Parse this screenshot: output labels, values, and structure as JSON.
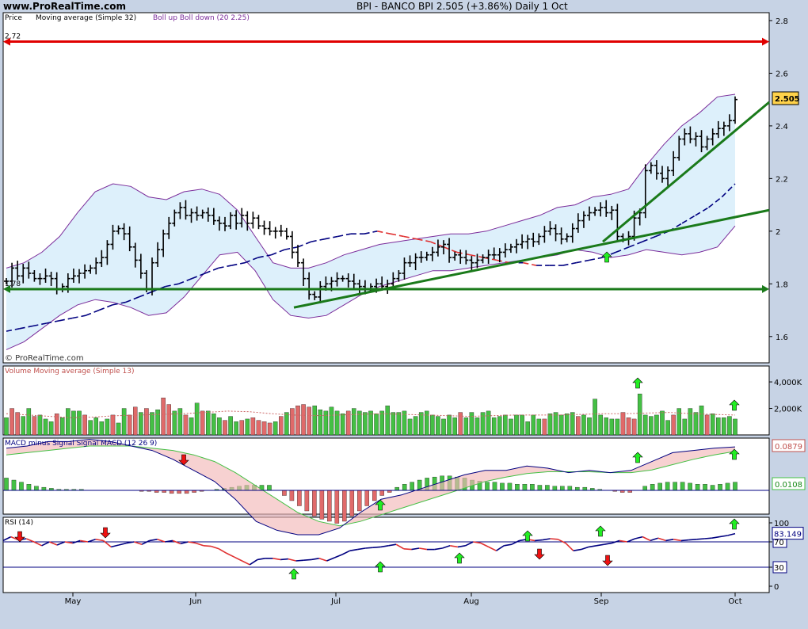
{
  "header": {
    "site": "www.ProRealTime.com",
    "title": "BPI - BANCO BPI    2.505 (+3.86%)    Daily  1 Oct"
  },
  "colors": {
    "price_bar": "#000000",
    "moving_average_up": "#000080",
    "moving_average_down": "#e03030",
    "bollinger_band": "#7b2c9a",
    "bollinger_fill": "#ddf0fb",
    "resistance_line": "#e00000",
    "support_line": "#1a7a1a",
    "volume_up": "#44c044",
    "volume_down": "#e06a6a",
    "macd_line": "#000080",
    "signal_line": "#44c044",
    "rsi_line": "#000080",
    "arrow_buy": "#22ee22",
    "arrow_sell": "#ee1111"
  },
  "chart_data": [
    {
      "type": "candlestick",
      "name": "price",
      "legend": [
        "Price",
        "Moving average (Simple 32)",
        "Boll up Boll down (20 2.25)"
      ],
      "ylim": [
        1.5,
        2.83
      ],
      "y_ticks": [
        "2.8",
        "2.6",
        "2.4",
        "2.2",
        "2",
        "1.8",
        "1.6"
      ],
      "x_labels": [
        "May",
        "Jun",
        "Jul",
        "Aug",
        "Sep",
        "Oct"
      ],
      "last_value_label": "2.505",
      "horizontal_levels": [
        {
          "label": "2.72",
          "value": 2.72,
          "style": "resistance"
        },
        {
          "label": "1.78",
          "value": 1.78,
          "style": "support"
        }
      ],
      "trendlines": [
        {
          "from": [
            "Jun 25",
            1.71
          ],
          "to": [
            "Oct 14",
            2.08
          ]
        },
        {
          "from": [
            "Sep 1",
            1.96
          ],
          "to": [
            "Oct 14",
            2.49
          ]
        }
      ],
      "close": [
        1.81,
        1.86,
        1.83,
        1.86,
        1.84,
        1.82,
        1.82,
        1.83,
        1.82,
        1.78,
        1.79,
        1.82,
        1.83,
        1.84,
        1.85,
        1.86,
        1.88,
        1.9,
        1.95,
        2.0,
        2.01,
        1.99,
        1.94,
        1.89,
        1.84,
        1.78,
        1.88,
        1.93,
        1.99,
        2.03,
        2.07,
        2.09,
        2.06,
        2.07,
        2.06,
        2.07,
        2.06,
        2.04,
        2.03,
        2.02,
        2.06,
        2.03,
        2.06,
        2.03,
        2.05,
        2.02,
        2.01,
        2.0,
        2.0,
        2.0,
        1.98,
        1.92,
        1.88,
        1.82,
        1.76,
        1.75,
        1.79,
        1.8,
        1.81,
        1.82,
        1.82,
        1.81,
        1.8,
        1.79,
        1.78,
        1.79,
        1.8,
        1.79,
        1.8,
        1.82,
        1.84,
        1.88,
        1.88,
        1.9,
        1.9,
        1.91,
        1.92,
        1.94,
        1.95,
        1.9,
        1.91,
        1.9,
        1.89,
        1.88,
        1.89,
        1.9,
        1.91,
        1.91,
        1.92,
        1.93,
        1.94,
        1.95,
        1.96,
        1.97,
        1.96,
        1.98,
        2.0,
        2.01,
        1.99,
        1.97,
        1.98,
        2.01,
        2.04,
        2.06,
        2.07,
        2.08,
        2.09,
        2.07,
        2.08,
        1.98,
        1.97,
        1.98,
        2.05,
        2.07,
        2.23,
        2.25,
        2.22,
        2.2,
        2.23,
        2.28,
        2.35,
        2.37,
        2.35,
        2.36,
        2.32,
        2.35,
        2.37,
        2.39,
        2.4,
        2.42,
        2.5
      ],
      "moving_average": [
        1.62,
        1.63,
        1.64,
        1.65,
        1.66,
        1.67,
        1.68,
        1.7,
        1.72,
        1.73,
        1.75,
        1.77,
        1.79,
        1.8,
        1.82,
        1.84,
        1.86,
        1.87,
        1.88,
        1.9,
        1.91,
        1.93,
        1.94,
        1.96,
        1.97,
        1.98,
        1.99,
        1.99,
        2.0,
        1.99,
        1.98,
        1.97,
        1.96,
        1.94,
        1.92,
        1.91,
        1.9,
        1.89,
        1.88,
        1.88,
        1.87,
        1.87,
        1.87,
        1.88,
        1.89,
        1.9,
        1.92,
        1.94,
        1.96,
        1.98,
        2.0,
        2.03,
        2.06,
        2.09,
        2.13,
        2.18
      ],
      "bollinger_upper": [
        1.86,
        1.88,
        1.92,
        1.98,
        2.07,
        2.15,
        2.18,
        2.17,
        2.13,
        2.12,
        2.15,
        2.16,
        2.14,
        2.08,
        1.98,
        1.88,
        1.86,
        1.86,
        1.88,
        1.91,
        1.93,
        1.95,
        1.96,
        1.97,
        1.98,
        1.99,
        1.99,
        2.0,
        2.02,
        2.04,
        2.06,
        2.09,
        2.1,
        2.13,
        2.14,
        2.16,
        2.25,
        2.33,
        2.4,
        2.45,
        2.51,
        2.52
      ],
      "bollinger_lower": [
        1.55,
        1.58,
        1.63,
        1.68,
        1.72,
        1.74,
        1.73,
        1.71,
        1.68,
        1.69,
        1.75,
        1.83,
        1.91,
        1.92,
        1.85,
        1.74,
        1.68,
        1.67,
        1.68,
        1.72,
        1.76,
        1.79,
        1.81,
        1.83,
        1.85,
        1.85,
        1.86,
        1.87,
        1.88,
        1.89,
        1.9,
        1.91,
        1.93,
        1.92,
        1.9,
        1.91,
        1.93,
        1.92,
        1.91,
        1.92,
        1.94,
        2.02
      ]
    },
    {
      "type": "bar",
      "name": "volume",
      "legend": "Volume Moving average (Simple 13)",
      "y_ticks": [
        "4,000K",
        "2,000K"
      ],
      "values": [
        1300,
        2000,
        1700,
        1400,
        2000,
        1400,
        1500,
        1200,
        1000,
        1600,
        1300,
        2000,
        1800,
        1800,
        1500,
        1100,
        1300,
        1000,
        1200,
        1500,
        900,
        2000,
        1500,
        2100,
        1700,
        2000,
        1700,
        1900,
        2800,
        2300,
        1800,
        2000,
        1500,
        1300,
        2400,
        1800,
        1800,
        1600,
        1300,
        1100,
        1400,
        1000,
        1100,
        1200,
        1300,
        1100,
        1000,
        900,
        1000,
        1400,
        1700,
        2000,
        2200,
        2300,
        2100,
        2200,
        1900,
        1800,
        2100,
        1800,
        1600,
        1800,
        2000,
        1800,
        1700,
        1800,
        1600,
        1800,
        2200,
        1700,
        1700,
        1800,
        1200,
        1400,
        1700,
        1800,
        1500,
        1400,
        1200,
        1500,
        1300,
        1700,
        1300,
        1700,
        1300,
        1700,
        1800,
        1300,
        1400,
        1500,
        1200,
        1500,
        1500,
        1000,
        1500,
        1200,
        1200,
        1600,
        1700,
        1500,
        1600,
        1700,
        1400,
        1500,
        1300,
        2700,
        1500,
        1300,
        1200,
        1200,
        1700,
        1300,
        1200,
        3100,
        1500,
        1400,
        1500,
        1800,
        1100,
        1500,
        2000,
        1200,
        2000,
        1700,
        2200,
        1500,
        1600,
        1300,
        1300,
        1400,
        1200
      ],
      "up_days": [
        1,
        0,
        0,
        1,
        1,
        0,
        1,
        1,
        1,
        0,
        1,
        1,
        1,
        1,
        0,
        1,
        1,
        1,
        1,
        0,
        1,
        1,
        0,
        0,
        1,
        0,
        1,
        1,
        0,
        0,
        1,
        1,
        0,
        1,
        1,
        0,
        1,
        1,
        1,
        0,
        1,
        1,
        0,
        1,
        0,
        0,
        0,
        0,
        1,
        0,
        1,
        0,
        0,
        0,
        0,
        1,
        1,
        1,
        1,
        1,
        1,
        0,
        1,
        1,
        1,
        1,
        1,
        1,
        1,
        1,
        1,
        1,
        1,
        1,
        1,
        1,
        1,
        1,
        1,
        1,
        1,
        0,
        1,
        1,
        1,
        1,
        1,
        1,
        1,
        1,
        1,
        1,
        1,
        1,
        1,
        1,
        0,
        1,
        1,
        1,
        1,
        1,
        0,
        1,
        1,
        1,
        1,
        1,
        1,
        1,
        0,
        0,
        0,
        1,
        1,
        1,
        1,
        1,
        1,
        0,
        1,
        1,
        1,
        1,
        1,
        0,
        1,
        1,
        1,
        1,
        1
      ],
      "moving_average": [
        1600,
        1500,
        1400,
        1300,
        1350,
        1450,
        1500,
        1550,
        1600,
        1700,
        1800,
        1750,
        1600,
        1500,
        1450,
        1500,
        1550,
        1600,
        1550,
        1500,
        1450,
        1400,
        1450,
        1500,
        1500,
        1500,
        1550,
        1600,
        1600,
        1650,
        1700,
        1600,
        1550,
        1500
      ]
    },
    {
      "type": "line",
      "name": "macd",
      "legend": "MACD minus Signal Signal MACD (12 26 9)",
      "value_labels": [
        "0.0879",
        "0.0108"
      ],
      "macd": [
        0.095,
        0.1,
        0.11,
        0.11,
        0.115,
        0.11,
        0.1,
        0.09,
        0.07,
        0.045,
        0.02,
        -0.02,
        -0.07,
        -0.09,
        -0.1,
        -0.1,
        -0.085,
        -0.05,
        -0.02,
        -0.01,
        0.005,
        0.02,
        0.035,
        0.045,
        0.045,
        0.055,
        0.05,
        0.04,
        0.045,
        0.04,
        0.045,
        0.065,
        0.085,
        0.09,
        0.095,
        0.098
      ],
      "signal": [
        0.08,
        0.085,
        0.09,
        0.095,
        0.1,
        0.1,
        0.1,
        0.095,
        0.09,
        0.08,
        0.065,
        0.04,
        0.01,
        -0.02,
        -0.05,
        -0.07,
        -0.08,
        -0.07,
        -0.055,
        -0.04,
        -0.025,
        -0.01,
        0.005,
        0.02,
        0.03,
        0.038,
        0.042,
        0.042,
        0.042,
        0.04,
        0.04,
        0.046,
        0.058,
        0.07,
        0.08,
        0.088
      ],
      "histogram": [
        0.012,
        0.01,
        0.008,
        0.006,
        0.004,
        0.003,
        0.002,
        0.001,
        0.001,
        0.001,
        0.001,
        0.0,
        0.0,
        0.0,
        0.0,
        0.0,
        0.0,
        0.0,
        -0.001,
        -0.001,
        -0.002,
        -0.002,
        -0.003,
        -0.003,
        -0.003,
        -0.002,
        -0.001,
        0.0,
        0.001,
        0.002,
        0.003,
        0.004,
        0.005,
        0.005,
        0.005,
        0.005,
        0.0,
        -0.005,
        -0.01,
        -0.015,
        -0.02,
        -0.025,
        -0.028,
        -0.03,
        -0.032,
        -0.03,
        -0.025,
        -0.02,
        -0.015,
        -0.01,
        -0.005,
        -0.002,
        0.003,
        0.006,
        0.008,
        0.01,
        0.012,
        0.013,
        0.014,
        0.014,
        0.013,
        0.012,
        0.01,
        0.009,
        0.008,
        0.008,
        0.007,
        0.007,
        0.006,
        0.006,
        0.006,
        0.005,
        0.005,
        0.004,
        0.004,
        0.004,
        0.003,
        0.003,
        0.002,
        0.001,
        0.0,
        -0.001,
        -0.002,
        -0.002,
        0.0,
        0.004,
        0.006,
        0.007,
        0.008,
        0.008,
        0.008,
        0.007,
        0.006,
        0.006,
        0.005,
        0.006,
        0.007,
        0.008
      ]
    },
    {
      "type": "line",
      "name": "rsi",
      "legend": "RSI (14)",
      "y_ticks": [
        "100",
        "70",
        "30",
        "0"
      ],
      "last_value_label": "83.149",
      "levels": [
        70,
        30
      ],
      "values": [
        72,
        78,
        73,
        75,
        70,
        64,
        70,
        65,
        70,
        68,
        72,
        70,
        74,
        72,
        62,
        65,
        68,
        70,
        66,
        72,
        74,
        70,
        72,
        67,
        70,
        68,
        64,
        63,
        59,
        52,
        46,
        40,
        34,
        42,
        44,
        44,
        42,
        43,
        40,
        41,
        42,
        44,
        40,
        45,
        50,
        56,
        58,
        60,
        61,
        62,
        64,
        66,
        59,
        58,
        60,
        58,
        58,
        60,
        64,
        62,
        64,
        70,
        68,
        62,
        56,
        64,
        66,
        72,
        74,
        72,
        73,
        75,
        74,
        68,
        56,
        58,
        62,
        64,
        66,
        68,
        72,
        70,
        75,
        78,
        72,
        76,
        72,
        74,
        72,
        73,
        74,
        75,
        76,
        78,
        80,
        83
      ]
    }
  ],
  "price_scale_labels": [
    "2.72",
    "1.78"
  ],
  "watermark": "© ProRealTime.com",
  "arrows": {
    "volume": [
      {
        "kind": "buy"
      },
      {
        "kind": "buy"
      }
    ],
    "macd": [
      {
        "kind": "sell"
      },
      {
        "kind": "buy"
      },
      {
        "kind": "buy"
      },
      {
        "kind": "buy"
      }
    ],
    "rsi": [
      {
        "kind": "sell"
      },
      {
        "kind": "sell"
      },
      {
        "kind": "buy"
      },
      {
        "kind": "buy"
      },
      {
        "kind": "buy"
      },
      {
        "kind": "buy"
      },
      {
        "kind": "sell"
      },
      {
        "kind": "buy"
      },
      {
        "kind": "sell"
      },
      {
        "kind": "buy"
      },
      {
        "kind": "buy"
      }
    ]
  }
}
